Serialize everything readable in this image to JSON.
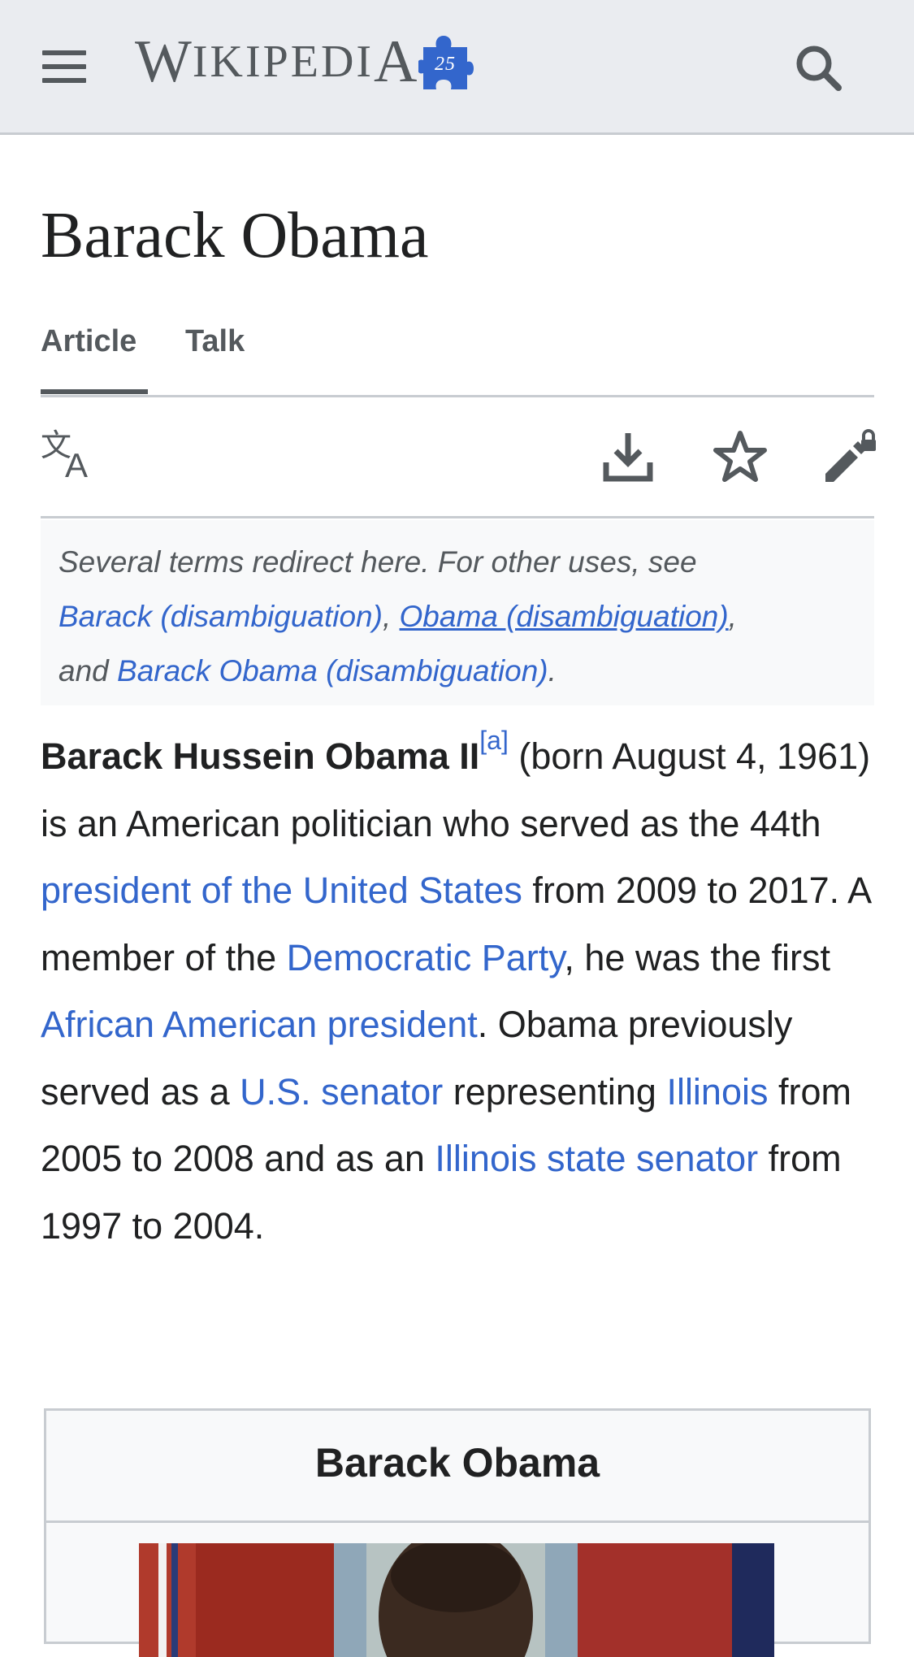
{
  "header": {
    "wordmark_initial": "W",
    "wordmark_rest": "IKIPEDI",
    "wordmark_final": "A",
    "anniversary_badge": "25",
    "menu_icon": "hamburger-menu-icon",
    "search_icon": "search-icon"
  },
  "article": {
    "title": "Barack Obama",
    "tabs": [
      {
        "label": "Article",
        "active": true
      },
      {
        "label": "Talk",
        "active": false
      }
    ],
    "toolbar_icons": [
      "language-icon",
      "download-icon",
      "watch-star-icon",
      "edit-lock-icon"
    ]
  },
  "hatnote": {
    "intro": "Several terms redirect here. For other uses, see",
    "link1": "Barack (disambiguation)",
    "sep1": ",",
    "link2": "Obama (disambiguation)",
    "sep2": ",",
    "and_text": "and",
    "link3": "Barack Obama (disambiguation)",
    "end": "."
  },
  "lead": {
    "name": "Barack Hussein Obama II",
    "footnote": "[a]",
    "t1": " (born August 4, 1961) is an American politician who served as the 44th ",
    "link_president": "president of the United States",
    "t2": " from 2009 to 2017. A member of the ",
    "link_party": "Democratic Party",
    "t3": ", he was the first ",
    "link_aa_president": "African American president",
    "t4": ". Obama previously served as a ",
    "link_senator": "U.S. senator",
    "t5": " representing ",
    "link_illinois": "Illinois",
    "t6": " from 2005 to 2008 and as an ",
    "link_state_senator": "Illinois state senator",
    "t7": " from 1997 to 2004."
  },
  "infobox": {
    "title": "Barack Obama"
  },
  "colors": {
    "link": "#3366cc",
    "header_bg": "#eaecf0",
    "text": "#202122",
    "muted": "#54595d",
    "border": "#c8ccd1",
    "puzzle": "#36c"
  }
}
